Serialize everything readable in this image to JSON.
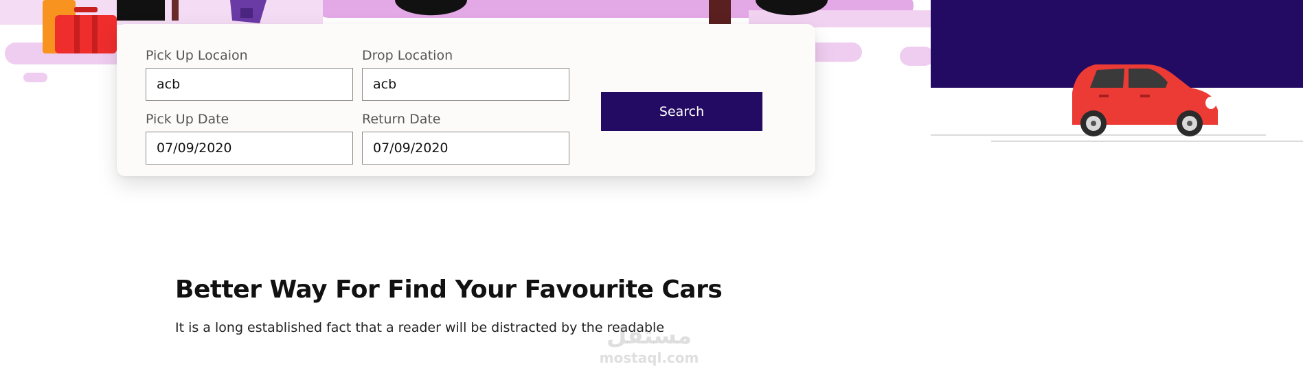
{
  "booking": {
    "pickup_location": {
      "label": "Pick Up Locaion",
      "value": "acb"
    },
    "drop_location": {
      "label": "Drop Location",
      "value": "acb"
    },
    "pickup_date": {
      "label": "Pick Up Date",
      "value": "07/09/2020"
    },
    "return_date": {
      "label": "Return Date",
      "value": "07/09/2020"
    },
    "search_label": "Search"
  },
  "intro": {
    "title": "Better Way For Find Your Favourite Cars",
    "text": "It is a long established fact that a reader will be distracted by the readable"
  },
  "watermark": {
    "arabic": "مستقل",
    "latin": "mostaql.com"
  },
  "colors": {
    "brand_dark": "#230b63",
    "hero_pink": "#e3a8e6",
    "car_red": "#ec3a34"
  }
}
